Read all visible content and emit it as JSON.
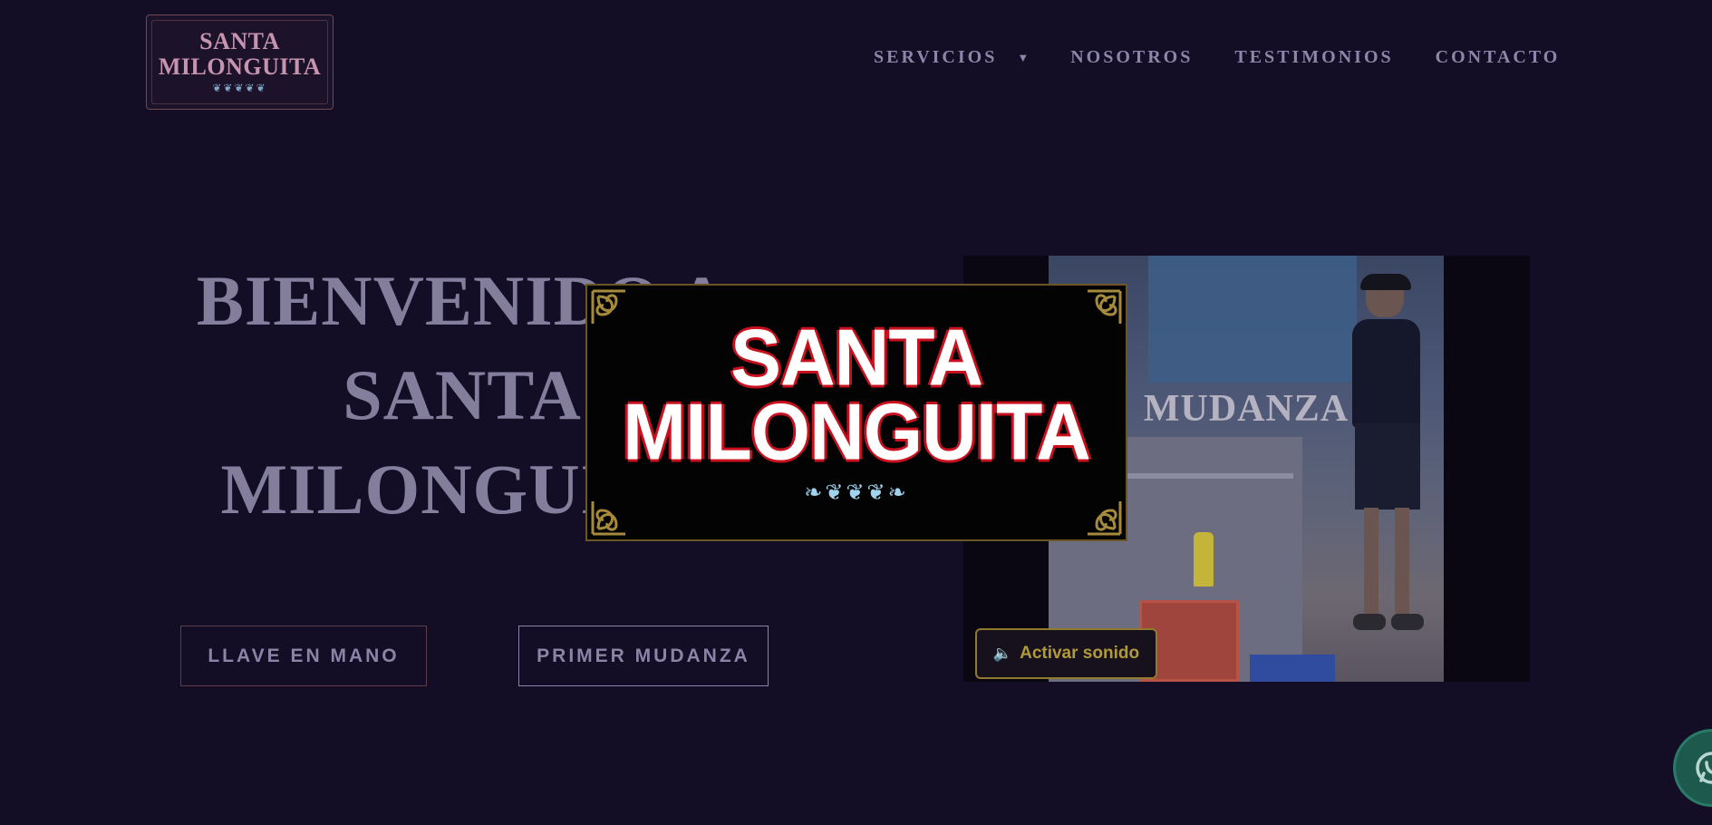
{
  "header": {
    "logo": {
      "line1": "SANTA",
      "line2": "MILONGUITA",
      "ornament": "❦❦❦❦❦"
    },
    "nav": [
      {
        "label": "SERVICIOS",
        "has_dropdown": true,
        "dropdown_icon": "caret-down-icon"
      },
      {
        "label": "NOSOTROS"
      },
      {
        "label": "TESTIMONIOS"
      },
      {
        "label": "CONTACTO"
      }
    ]
  },
  "hero": {
    "title_lines": [
      "BIENVENIDO A",
      "SANTA",
      "MILONGUITA"
    ],
    "buttons": [
      {
        "label": "LLAVE EN MANO"
      },
      {
        "label": "PRIMER MUDANZA"
      }
    ]
  },
  "video": {
    "caption": "MUDANZA",
    "sound_button": {
      "label": "Activar sonido",
      "icon": "speaker-icon"
    }
  },
  "overlay_logo": {
    "line1": "SANTA",
    "line2": "MILONGUITA",
    "ornament": "❧❦❦❦❧"
  },
  "floating": {
    "whatsapp_icon": "whatsapp-icon"
  },
  "colors": {
    "background": "#130d26",
    "nav_text": "#8c87a8",
    "hero_text": "#837e9c",
    "sound_button_text": "#b09a3a",
    "overlay_border_red": "#c9101e"
  }
}
